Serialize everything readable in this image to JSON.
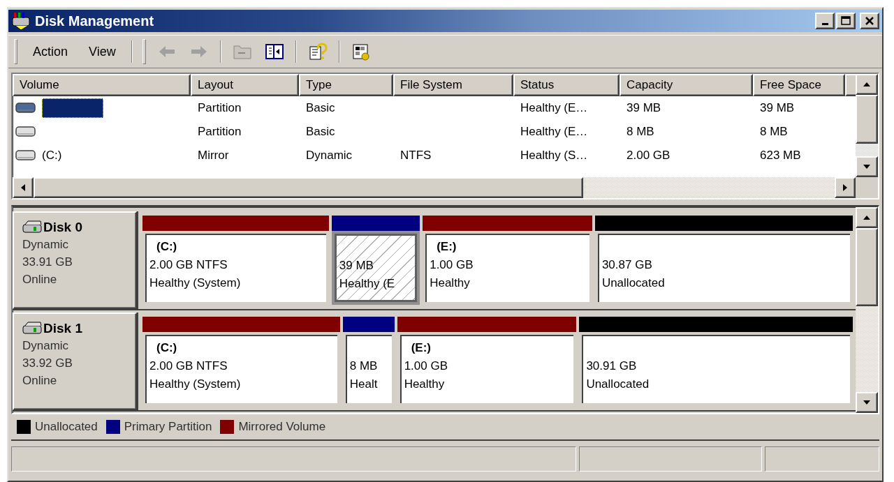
{
  "window": {
    "title": "Disk Management"
  },
  "toolbar": {
    "menus": [
      {
        "label": "Action"
      },
      {
        "label": "View"
      }
    ],
    "buttons": [
      {
        "kind": "back",
        "disabled": true,
        "separator_before": false
      },
      {
        "kind": "forward",
        "disabled": true,
        "separator_before": false
      },
      {
        "kind": "up",
        "disabled": true,
        "separator_before": true
      },
      {
        "kind": "tree",
        "disabled": false,
        "separator_before": false
      },
      {
        "kind": "help",
        "disabled": false,
        "separator_before": true
      },
      {
        "kind": "properties",
        "disabled": false,
        "separator_before": true
      }
    ]
  },
  "volume_list": {
    "columns": [
      "Volume",
      "Layout",
      "Type",
      "File System",
      "Status",
      "Capacity",
      "Free Space"
    ],
    "rows": [
      {
        "selected": true,
        "layout": "Partition",
        "type": "Basic",
        "status": "Healthy (E…",
        "capacity": "39 MB",
        "free_space": "39 MB"
      },
      {
        "selected": false,
        "layout": "Partition",
        "type": "Basic",
        "status": "Healthy (E…",
        "capacity": "8 MB",
        "free_space": "8 MB"
      },
      {
        "selected": false,
        "volume": "(C:)",
        "layout": "Mirror",
        "type": "Dynamic",
        "file_system": "NTFS",
        "status": "Healthy (S…",
        "capacity": "2.00 GB",
        "free_space": "623 MB"
      }
    ]
  },
  "disks": [
    {
      "name": "Disk 0",
      "type": "Dynamic",
      "size": "33.91 GB",
      "state": "Online",
      "partitions": [
        {
          "color": "#800000",
          "selected": false,
          "label": "(C:)",
          "size": "2.00 GB NTFS",
          "status": "Healthy (System)"
        },
        {
          "color": "#000080",
          "selected": true,
          "size": "39 MB",
          "status": "Healthy (E"
        },
        {
          "color": "#800000",
          "selected": false,
          "label": "(E:)",
          "size": "1.00 GB",
          "status": "Healthy"
        },
        {
          "color": "#000000",
          "selected": false,
          "size": "30.87 GB",
          "status": "Unallocated"
        }
      ]
    },
    {
      "name": "Disk 1",
      "type": "Dynamic",
      "size": "33.92 GB",
      "state": "Online",
      "partitions": [
        {
          "color": "#800000",
          "selected": false,
          "label": "(C:)",
          "size": "2.00 GB NTFS",
          "status": "Healthy (System)"
        },
        {
          "color": "#000080",
          "selected": false,
          "size": "8 MB",
          "status": "Healt"
        },
        {
          "color": "#800000",
          "selected": false,
          "label": "(E:)",
          "size": "1.00 GB",
          "status": "Healthy"
        },
        {
          "color": "#000000",
          "selected": false,
          "size": "30.91 GB",
          "status": "Unallocated"
        }
      ]
    }
  ],
  "legend": [
    {
      "label": "Unallocated",
      "color": "#000000"
    },
    {
      "label": "Primary Partition",
      "color": "#000080"
    },
    {
      "label": "Mirrored Volume",
      "color": "#800000"
    }
  ]
}
